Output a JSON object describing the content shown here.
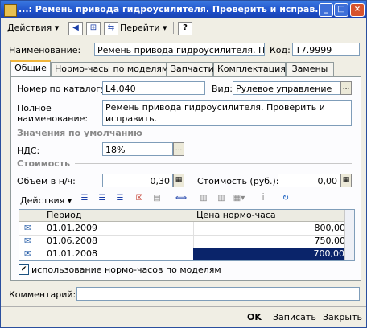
{
  "window": {
    "title": "...: Ремень привода гидроусилителя. Проверить и исправ..."
  },
  "toolbar": {
    "actions_label": "Действия",
    "goto_label": "Перейти",
    "help_label": "?"
  },
  "header": {
    "name_label": "Наименование:",
    "name_value": "Ремень привода гидроусилителя. Проверить",
    "code_label": "Код:",
    "code_value": "Т7.9999"
  },
  "tabs": [
    "Общие",
    "Нормо-часы по моделям",
    "Запчасти",
    "Комплектация",
    "Замены"
  ],
  "general": {
    "catalog_label": "Номер по каталогу:",
    "catalog_value": "L4.040",
    "kind_label": "Вид:",
    "kind_value": "Рулевое управление",
    "fullname_label": "Полное наименование:",
    "fullname_value": "Ремень привода гидроусилителя. Проверить и исправить.",
    "defaults_section": "Значения по умолчанию",
    "vat_label": "НДС:",
    "vat_value": "18%",
    "cost_section": "Стоимость",
    "volume_label": "Объем в н/ч:",
    "volume_value": "0,30",
    "cost_label": "Стоимость (руб.):",
    "cost_value": "0,00"
  },
  "table": {
    "actions_label": "Действия",
    "columns": [
      "Период",
      "Цена нормо-часа"
    ],
    "rows": [
      {
        "period": "01.01.2009",
        "price": "800,00"
      },
      {
        "period": "01.06.2008",
        "price": "750,00"
      },
      {
        "period": "01.01.2008",
        "price": "700,00"
      }
    ],
    "checkbox_label": "использование нормо-часов по моделям"
  },
  "comment": {
    "label": "Комментарий:",
    "value": ""
  },
  "buttons": {
    "ok": "OK",
    "save": "Записать",
    "close": "Закрыть"
  },
  "colors": {
    "titlebar": "#1e4fc9",
    "selection": "#0a246a",
    "tab_accent": "#f0b43a"
  }
}
